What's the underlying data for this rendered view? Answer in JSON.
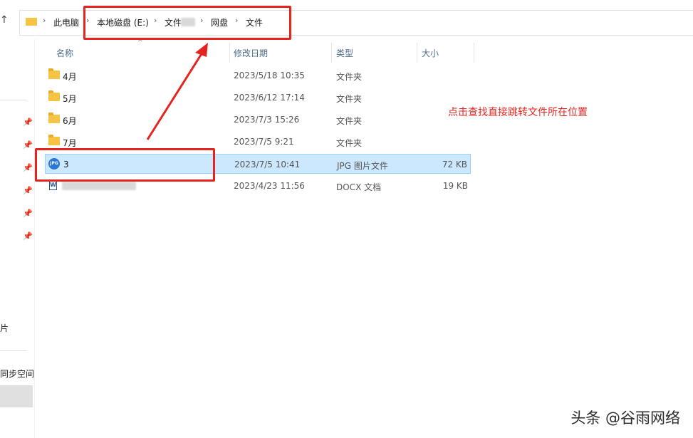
{
  "breadcrumb": {
    "items": [
      "此电脑",
      "本地磁盘 (E:)",
      "文件",
      "网盘",
      "文件"
    ],
    "separator": "›"
  },
  "columns": {
    "name": "名称",
    "modified": "修改日期",
    "type": "类型",
    "size": "大小"
  },
  "files": [
    {
      "name": "4月",
      "modified": "2023/5/18 10:35",
      "type": "文件夹",
      "size": "",
      "icon": "folder-icon"
    },
    {
      "name": "5月",
      "modified": "2023/6/12 17:14",
      "type": "文件夹",
      "size": "",
      "icon": "folder-icon"
    },
    {
      "name": "6月",
      "modified": "2023/7/3 15:26",
      "type": "文件夹",
      "size": "",
      "icon": "folder-icon"
    },
    {
      "name": "7月",
      "modified": "2023/7/5 9:21",
      "type": "文件夹",
      "size": "",
      "icon": "folder-icon"
    },
    {
      "name": "3",
      "modified": "2023/7/5 10:41",
      "type": "JPG 图片文件",
      "size": "72 KB",
      "icon": "jpg-file-icon",
      "selected": true
    },
    {
      "name": "",
      "modified": "2023/4/23 11:56",
      "type": "DOCX 文档",
      "size": "19 KB",
      "icon": "docx-file-icon"
    }
  ],
  "sidebar": {
    "partial_labels": [
      "片",
      "同步空间"
    ]
  },
  "annotation": {
    "note": "点击查找直接跳转文件所在位置",
    "color": "#e5241f"
  },
  "watermark": "头条 @谷雨网络",
  "icons": {
    "jpg_label": "JPG",
    "docx_label": "W"
  },
  "colors": {
    "selection": "#cce8ff",
    "folder": "#f6c443",
    "header_text": "#4d6b8a"
  }
}
